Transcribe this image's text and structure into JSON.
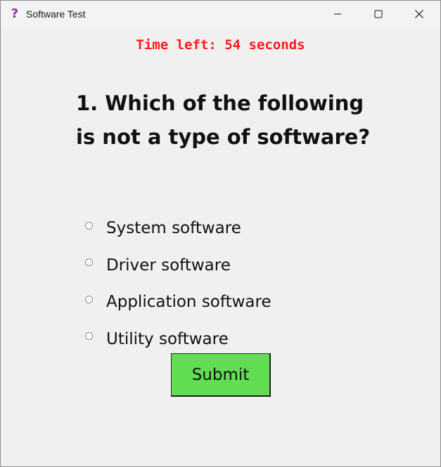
{
  "window": {
    "title": "Software Test",
    "app_icon": "question-mark-icon"
  },
  "controls": {
    "minimize_icon": "minimize-icon",
    "maximize_icon": "maximize-icon",
    "close_icon": "close-icon"
  },
  "timer": {
    "text": "Time left: 54 seconds",
    "color": "#ff1a1a"
  },
  "question": {
    "text": "1. Which of the following is not a type of software?"
  },
  "options": [
    {
      "label": "System software",
      "selected": false
    },
    {
      "label": "Driver software",
      "selected": false
    },
    {
      "label": "Application software",
      "selected": false
    },
    {
      "label": "Utility software",
      "selected": false
    }
  ],
  "submit": {
    "label": "Submit",
    "color": "#60dd50"
  },
  "colors": {
    "background": "#f0f0f0",
    "icon": "#8e2fa8"
  }
}
